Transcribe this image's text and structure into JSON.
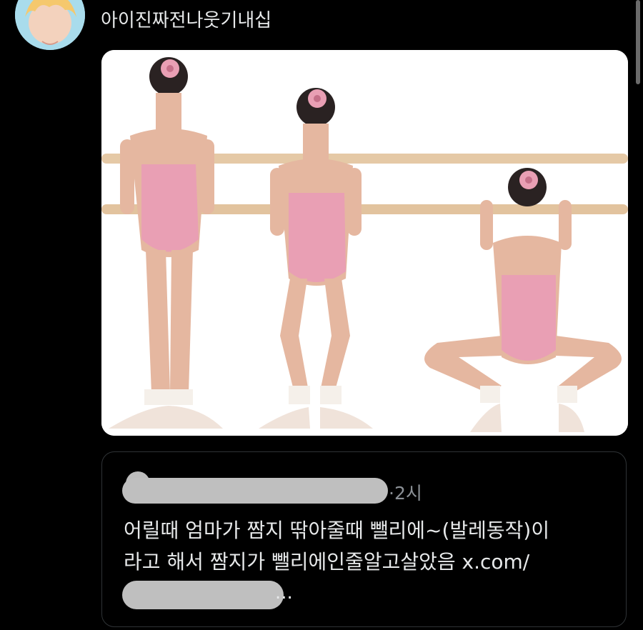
{
  "post": {
    "author_name": "아이진짜전나웃기내십",
    "image_alt": "ballet dancers at barre"
  },
  "quote": {
    "time": "·2시",
    "text_line1": "어릴때 엄마가 짬지 딲아줄때 뺄리에~(발레동작)이",
    "text_line2": "라고 해서 짬지가 뺄리에인줄알고살았음 x.com/",
    "text_line3": "..."
  },
  "colors": {
    "background": "#000000",
    "text": "#e7e9ea",
    "muted": "#8b9096",
    "border": "#2f3336",
    "leotard": "#e99fb4",
    "skin": "#e5b7a0",
    "barre": "#e5c9a6"
  },
  "icons": {
    "avatar": "anime-avatar",
    "censor": "blur-scribble"
  }
}
